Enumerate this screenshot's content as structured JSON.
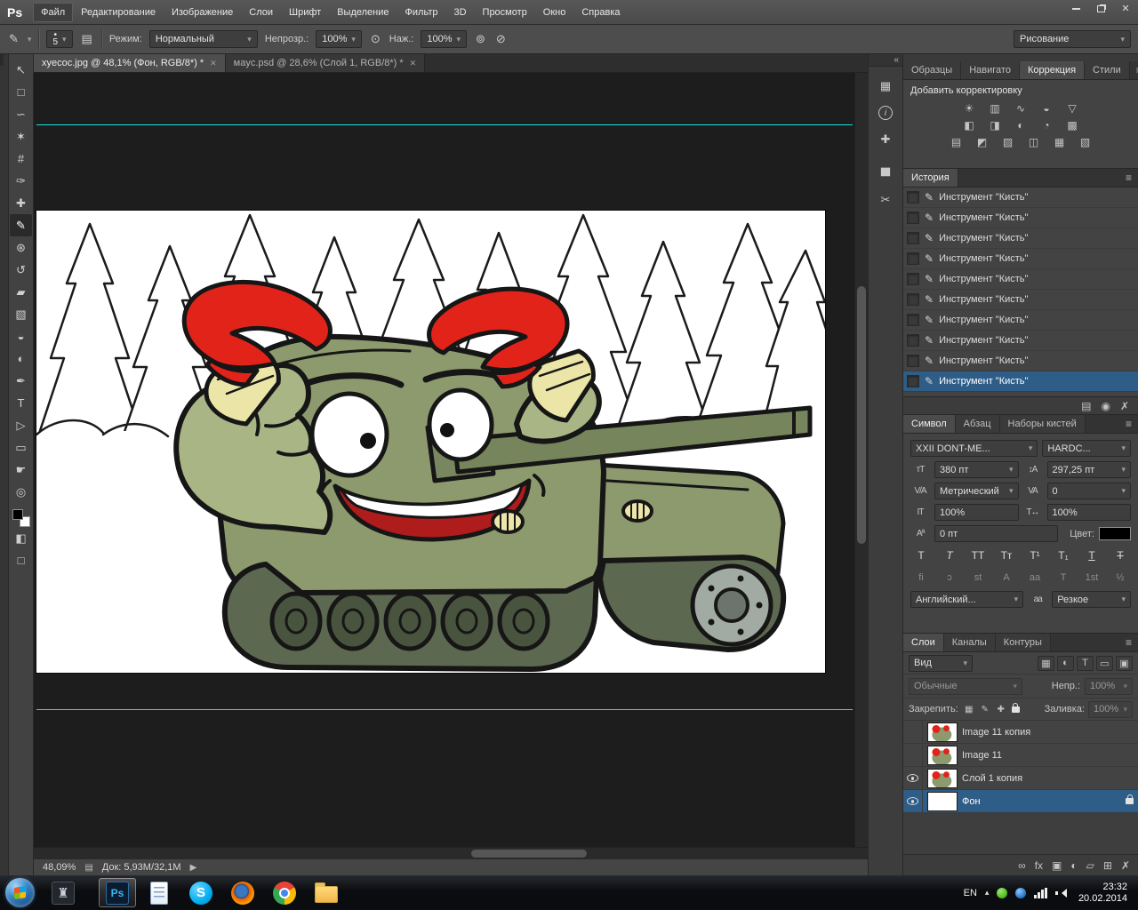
{
  "icons": {
    "dropdown_arrow": "▾",
    "panel_menu": "≡",
    "close": "✕",
    "collapse": "«",
    "tab_close": "✕",
    "status_play": "▶",
    "brush_dot": "•",
    "status_doc": "▤"
  },
  "window": {
    "logo": "Ps"
  },
  "menubar": {
    "items": [
      {
        "label": "Файл",
        "active": true
      },
      {
        "label": "Редактирование"
      },
      {
        "label": "Изображение"
      },
      {
        "label": "Слои"
      },
      {
        "label": "Шрифт"
      },
      {
        "label": "Выделение"
      },
      {
        "label": "Фильтр"
      },
      {
        "label": "3D"
      },
      {
        "label": "Просмотр"
      },
      {
        "label": "Окно"
      },
      {
        "label": "Справка"
      }
    ]
  },
  "options": {
    "tool_glyph": "✎",
    "brush_size": "5",
    "mode_label": "Режим:",
    "mode_value": "Нормальный",
    "opacity_label": "Непрозр.:",
    "opacity_value": "100%",
    "flow_label": "Наж.:",
    "flow_value": "100%",
    "workspace": "Рисование"
  },
  "toolbar": {
    "tools": [
      {
        "name": "tool-move",
        "glyph": "↖"
      },
      {
        "name": "tool-marquee",
        "glyph": "□"
      },
      {
        "name": "tool-lasso",
        "glyph": "∽"
      },
      {
        "name": "tool-magic-wand",
        "glyph": "✶"
      },
      {
        "name": "tool-crop",
        "glyph": "#"
      },
      {
        "name": "tool-eyedropper",
        "glyph": "✑"
      },
      {
        "name": "tool-healing-brush",
        "glyph": "✚"
      },
      {
        "name": "tool-brush",
        "glyph": "✎",
        "active": true
      },
      {
        "name": "tool-clone-stamp",
        "glyph": "⊛"
      },
      {
        "name": "tool-history-brush",
        "glyph": "↺"
      },
      {
        "name": "tool-eraser",
        "glyph": "▰"
      },
      {
        "name": "tool-gradient",
        "glyph": "▧"
      },
      {
        "name": "tool-blur",
        "glyph": "◒"
      },
      {
        "name": "tool-dodge",
        "glyph": "◐"
      },
      {
        "name": "tool-pen",
        "glyph": "✒"
      },
      {
        "name": "tool-type",
        "glyph": "T"
      },
      {
        "name": "tool-path-selection",
        "glyph": "▷"
      },
      {
        "name": "tool-shape",
        "glyph": "▭"
      },
      {
        "name": "tool-hand",
        "glyph": "☛"
      },
      {
        "name": "tool-zoom",
        "glyph": "◎"
      }
    ],
    "quick_mask_glyph": "◧",
    "screen_mode_glyph": "□"
  },
  "doc_tabs": [
    {
      "name": "doc-tab-xyecoc",
      "title": "xyecoc.jpg @ 48,1% (Фон, RGB/8*) *",
      "active": true
    },
    {
      "name": "doc-tab-mayc",
      "title": "мayc.psd @ 28,6% (Слой 1, RGB/8*) *",
      "active": false
    }
  ],
  "statusbar": {
    "zoom": "48,09%",
    "doc_info": "Док: 5,93M/32,1M"
  },
  "canvas": {
    "art_colors": {
      "tank_green": "#8d9a6e",
      "arm_green": "#a9b585",
      "claw_red": "#e2231a",
      "cuff_yellow": "#ece5a8",
      "track_olive": "#5d6850",
      "mouth_red": "#ae1c1c",
      "guide_cyan": "#17e3e3"
    }
  },
  "panel_strip": {
    "icons": [
      {
        "name": "swatches-mini-icon",
        "glyph": "▦"
      },
      {
        "name": "info-mini-icon",
        "glyph": "i",
        "circle": true
      },
      {
        "name": "color-sampler-mini-icon",
        "glyph": "✚"
      },
      {
        "name": "histogram-mini-icon",
        "glyph": "▅"
      },
      {
        "name": "scissors-mini-icon",
        "glyph": "✂"
      }
    ]
  },
  "panels": {
    "group1": {
      "tabs": [
        {
          "name": "tab-obraztsy",
          "label": "Образцы"
        },
        {
          "name": "tab-navigator",
          "label": "Навигато"
        },
        {
          "name": "tab-korrekciya",
          "label": "Коррекция",
          "active": true
        },
        {
          "name": "tab-stili",
          "label": "Стили"
        }
      ],
      "add_adjustment": "Добавить корректировку",
      "adj_row1": [
        {
          "name": "adj-brightness-contrast-icon",
          "glyph": "☀"
        },
        {
          "name": "adj-levels-icon",
          "glyph": "▥"
        },
        {
          "name": "adj-curves-icon",
          "glyph": "∿"
        },
        {
          "name": "adj-exposure-icon",
          "glyph": "◒"
        },
        {
          "name": "adj-vibrance-icon",
          "glyph": "▽"
        }
      ],
      "adj_row2": [
        {
          "name": "adj-hue-saturation-icon",
          "glyph": "◧"
        },
        {
          "name": "adj-color-balance-icon",
          "glyph": "◨"
        },
        {
          "name": "adj-black-white-icon",
          "glyph": "◐"
        },
        {
          "name": "adj-photo-filter-icon",
          "glyph": "◔"
        },
        {
          "name": "adj-channel-mixer-icon",
          "glyph": "▩"
        }
      ],
      "adj_row3": [
        {
          "name": "adj-color-lookup-icon",
          "glyph": "▤"
        },
        {
          "name": "adj-invert-icon",
          "glyph": "◩"
        },
        {
          "name": "adj-posterize-icon",
          "glyph": "▨"
        },
        {
          "name": "adj-threshold-icon",
          "glyph": "◫"
        },
        {
          "name": "adj-gradient-map-icon",
          "glyph": "▦"
        },
        {
          "name": "adj-selective-color-icon",
          "glyph": "▧"
        }
      ]
    },
    "history": {
      "tab": "История",
      "entries": [
        {
          "label": "Инструмент \"Кисть\""
        },
        {
          "label": "Инструмент \"Кисть\""
        },
        {
          "label": "Инструмент \"Кисть\""
        },
        {
          "label": "Инструмент \"Кисть\""
        },
        {
          "label": "Инструмент \"Кисть\""
        },
        {
          "label": "Инструмент \"Кисть\""
        },
        {
          "label": "Инструмент \"Кисть\""
        },
        {
          "label": "Инструмент \"Кисть\""
        },
        {
          "label": "Инструмент \"Кисть\""
        },
        {
          "label": "Инструмент \"Кисть\"",
          "selected": true
        }
      ],
      "footer_icons": [
        {
          "name": "new-doc-from-state-icon",
          "glyph": "▤"
        },
        {
          "name": "new-snapshot-icon",
          "glyph": "◉"
        },
        {
          "name": "delete-state-icon",
          "glyph": "✗"
        }
      ]
    },
    "character": {
      "tabs": [
        {
          "name": "tab-simvol",
          "label": "Символ",
          "active": true
        },
        {
          "name": "tab-abzac",
          "label": "Абзац"
        },
        {
          "name": "tab-nabory-kistey",
          "label": "Наборы кистей"
        }
      ],
      "font_family": "XXII DONT-ME...",
      "font_style": "HARDC...",
      "icon_labels": {
        "size": "тT",
        "leading": "↕A",
        "kerning": "V/A",
        "tracking": "VA",
        "vscale": "IT",
        "hscale": "T↔",
        "baseline": "Aª",
        "antialias": "aa"
      },
      "size_value": "380 пт",
      "leading_value": "297,25 пт",
      "kerning_value": "Метрический",
      "tracking_value": "0",
      "vscale_value": "100%",
      "hscale_value": "100%",
      "baseline_value": "0 пт",
      "color_label": "Цвет:",
      "style_buttons": [
        {
          "name": "faux-bold-button",
          "glyph": "T"
        },
        {
          "name": "faux-italic-button",
          "glyph": "T",
          "style": "italic"
        },
        {
          "name": "all-caps-button",
          "glyph": "TT"
        },
        {
          "name": "small-caps-button",
          "glyph": "Tт"
        },
        {
          "name": "superscript-button",
          "glyph": "T¹"
        },
        {
          "name": "subscript-button",
          "glyph": "T₁"
        },
        {
          "name": "underline-button",
          "glyph": "T",
          "style": "underline"
        },
        {
          "name": "strikethrough-button",
          "glyph": "T",
          "style": "strike"
        }
      ],
      "opentype_buttons": [
        {
          "name": "ligatures-button",
          "glyph": "fi",
          "dim": true
        },
        {
          "name": "contextual-alternates-button",
          "glyph": "ɔ",
          "dim": true
        },
        {
          "name": "discretionary-ligatures-button",
          "glyph": "st",
          "dim": true
        },
        {
          "name": "swash-button",
          "glyph": "A",
          "dim": true
        },
        {
          "name": "stylistic-alternates-button",
          "glyph": "aa",
          "dim": true
        },
        {
          "name": "titling-alternates-button",
          "glyph": "T",
          "dim": true
        },
        {
          "name": "ordinals-button",
          "glyph": "1st",
          "dim": true
        },
        {
          "name": "fractions-button",
          "glyph": "½",
          "dim": true
        }
      ],
      "language_value": "Английский...",
      "antialias_value": "Резкое"
    },
    "layers": {
      "tabs": [
        {
          "name": "tab-sloi",
          "label": "Слои",
          "active": true
        },
        {
          "name": "tab-kanaly",
          "label": "Каналы"
        },
        {
          "name": "tab-kontury",
          "label": "Контуры"
        }
      ],
      "filter_label": "Вид",
      "filter_icons": [
        {
          "name": "filter-pixel-icon",
          "glyph": "▦"
        },
        {
          "name": "filter-adjustment-icon",
          "glyph": "◐"
        },
        {
          "name": "filter-type-icon",
          "glyph": "T"
        },
        {
          "name": "filter-shape-icon",
          "glyph": "▭"
        },
        {
          "name": "filter-smart-icon",
          "glyph": "▣"
        }
      ],
      "blend_mode": "Обычные",
      "opacity_label": "Непр.:",
      "opacity_value": "100%",
      "lock_label": "Закрепить:",
      "lock_icons": [
        {
          "name": "lock-transparency-icon",
          "glyph": "▦"
        },
        {
          "name": "lock-pixels-icon",
          "glyph": "✎"
        },
        {
          "name": "lock-position-icon",
          "glyph": "✚"
        }
      ],
      "fill_label": "Заливка:",
      "fill_value": "100%",
      "rows": [
        {
          "name": "layer-row-image11-copy",
          "label": "Image 11 копия",
          "visible": false,
          "thumb": "tank",
          "selected": false
        },
        {
          "name": "layer-row-image11",
          "label": "Image 11",
          "visible": false,
          "thumb": "tank",
          "selected": false
        },
        {
          "name": "layer-row-sloy1-copy",
          "label": "Слой 1 копия",
          "visible": true,
          "thumb": "tank",
          "selected": false
        },
        {
          "name": "layer-row-fon",
          "label": "Фон",
          "visible": true,
          "thumb": "white",
          "selected": true,
          "locked": true
        }
      ],
      "footer_icons": [
        {
          "name": "link-layers-icon",
          "glyph": "∞"
        },
        {
          "name": "layer-effects-icon",
          "glyph": "fx"
        },
        {
          "name": "layer-mask-icon",
          "glyph": "▣"
        },
        {
          "name": "new-adjustment-icon",
          "glyph": "◐"
        },
        {
          "name": "new-group-icon",
          "glyph": "▱"
        },
        {
          "name": "new-layer-icon",
          "glyph": "⊞"
        },
        {
          "name": "delete-layer-icon",
          "glyph": "✗"
        }
      ]
    }
  },
  "taskbar": {
    "items": [
      {
        "name": "taskbar-wot-button",
        "kind": "wot",
        "glyph": "♜"
      },
      {
        "name": "taskbar-photoshop-button",
        "kind": "ps",
        "glyph": "Ps",
        "active": true
      },
      {
        "name": "taskbar-document-button",
        "kind": "doc",
        "glyph": ""
      },
      {
        "name": "taskbar-skype-button",
        "kind": "skype",
        "glyph": "S"
      },
      {
        "name": "taskbar-firefox-button",
        "kind": "firefox",
        "glyph": ""
      },
      {
        "name": "taskbar-chrome-button",
        "kind": "chrome",
        "glyph": ""
      },
      {
        "name": "taskbar-explorer-button",
        "kind": "folder",
        "glyph": ""
      }
    ],
    "tray": {
      "lang": "EN",
      "time": "23:32",
      "date": "20.02.2014"
    }
  }
}
